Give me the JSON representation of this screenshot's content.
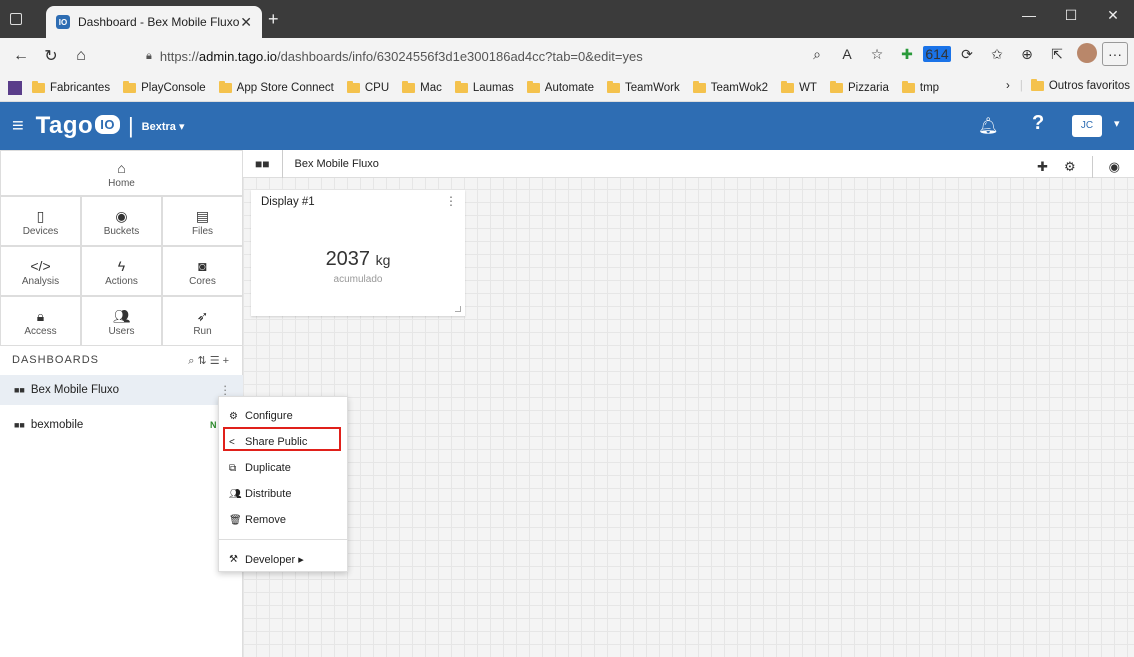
{
  "browser": {
    "tab_title": "Dashboard - Bex Mobile Fluxo",
    "tab_logo": "IO",
    "url_prefix": "https://",
    "url_host": "admin.tago.io",
    "url_path": "/dashboards/info/63024556f3d1e300186ad4cc?tab=0&edit=yes",
    "ext_badge": "614",
    "bookmarks": [
      "Fabricantes",
      "PlayConsole",
      "App Store Connect",
      "CPU",
      "Mac",
      "Laumas",
      "Automate",
      "TeamWork",
      "TeamWok2",
      "WT",
      "Pizzaria",
      "tmp"
    ],
    "other_favorites": "Outros favoritos"
  },
  "appbar": {
    "logo_text": "Tago",
    "logo_io": "IO",
    "account": "Bextra ▾",
    "user_initials": "JC"
  },
  "sidebar": {
    "home": "Home",
    "items": [
      "Devices",
      "Buckets",
      "Files",
      "Analysis",
      "Actions",
      "Cores",
      "Access",
      "Users",
      "Run"
    ],
    "dashboards_header": "DASHBOARDS",
    "dashboards": [
      {
        "label": "Bex Mobile Fluxo"
      },
      {
        "label": "bexmobile",
        "badge": "N"
      }
    ]
  },
  "main": {
    "title": "Bex Mobile Fluxo",
    "widget": {
      "title": "Display #1",
      "value": "2037",
      "unit": "kg",
      "subtitle": "acumulado"
    }
  },
  "context_menu": {
    "items": [
      "Configure",
      "Share Public",
      "Duplicate",
      "Distribute",
      "Remove"
    ],
    "developer": "Developer ▸",
    "highlighted": "Share Public"
  },
  "colors": {
    "brand": "#2e6db3",
    "highlight": "#e0201a"
  }
}
